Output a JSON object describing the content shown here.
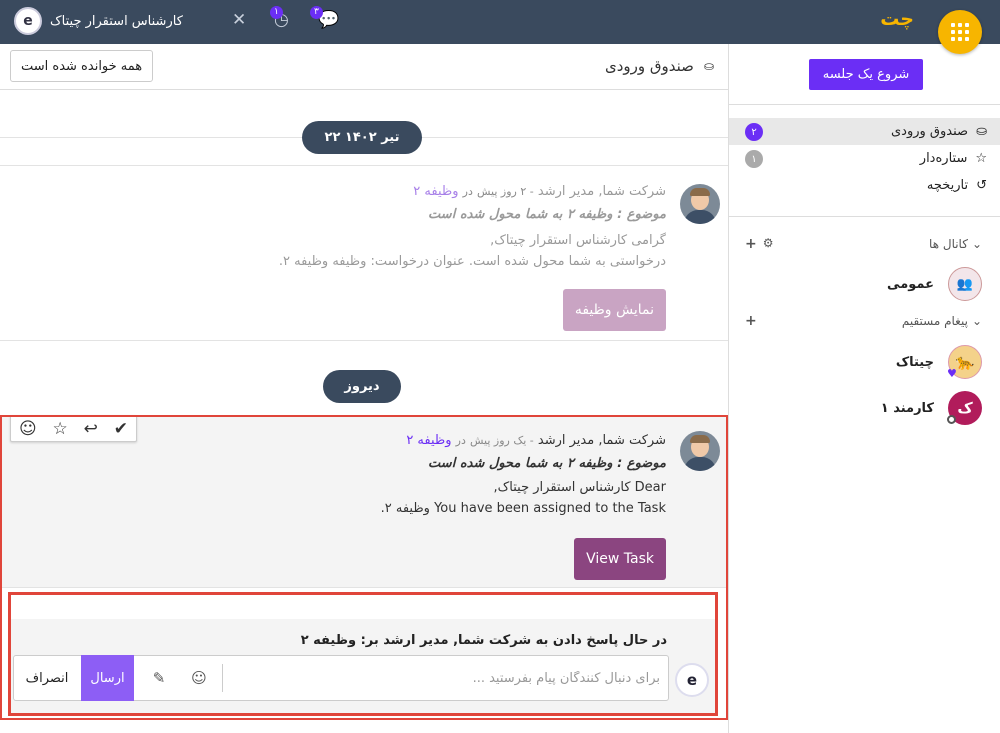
{
  "topbar": {
    "app_title": "چت",
    "user_name": "کارشناس استقرار چیتاک",
    "user_initial": "e",
    "messages_count": "۳",
    "activities_count": "۱",
    "apps_icon": "grid-icon",
    "messages_icon": "chat-bubbles-icon",
    "activities_icon": "clock-icon",
    "close_icon": "close-icon"
  },
  "sidebar": {
    "start_meeting": "شروع یک جلسه",
    "mailboxes": [
      {
        "label": "صندوق ورودی",
        "icon": "inbox-icon",
        "counter": "۲"
      },
      {
        "label": "ستاره‌دار",
        "icon": "star-icon",
        "counter": "۱"
      },
      {
        "label": "تاریخچه",
        "icon": "history-icon"
      }
    ],
    "channels_header": "کانال ها",
    "channels": [
      {
        "label": "عمومی",
        "icon": "group-icon"
      }
    ],
    "direct_header": "پیغام مستقیم",
    "direct": [
      {
        "label": "چیتاک",
        "icon": "cheetah-icon"
      },
      {
        "label": "کارمند ۱",
        "initial": "ک"
      }
    ]
  },
  "main": {
    "inbox_title": "صندوق ورودی",
    "mark_all_read": "همه خوانده شده است",
    "date_1": "۲۲ تیر ۱۴۰۲",
    "date_2": "دیروز",
    "messages": [
      {
        "author": "شرکت شما, مدیر ارشد",
        "time": "- ۲ روز پیش",
        "in": "در",
        "record": "وظیفه ۲",
        "subject": "موضوع : وظیفه ۲ به شما محول شده است",
        "line1": "گرامی کارشناس استقرار چیتاک,",
        "line2": "درخواستی به شما محول شده است. عنوان درخواست: وظیفه وظیفه ۲.",
        "button": "نمایش وظیفه"
      },
      {
        "author": "شرکت شما, مدیر ارشد",
        "time": "- یک روز پیش",
        "in": "در",
        "record": "وظیفه ۲",
        "subject": "موضوع : وظیفه ۲ به شما محول شده است",
        "line1": "Dear کارشناس استقرار چیتاک,",
        "line2": "You have been assigned to the Task وظیفه ۲.",
        "button": "View Task"
      }
    ]
  },
  "composer": {
    "replying_to": "در حال پاسخ دادن به شرکت شما, مدیر ارشد بر: وظیفه ۲",
    "placeholder": "برای دنبال کنندگان پیام بفرستید ...",
    "value": "",
    "send": "ارسال",
    "cancel": "انصراف",
    "emoji_icon": "smiley-icon",
    "attach_icon": "paperclip-icon"
  },
  "colors": {
    "navbar": "#3a4a5e",
    "accent": "#6b2ef5",
    "apps_button": "#f7b500",
    "highlight": "#e0453a",
    "faded_button": "#c9a4c3",
    "view_button": "#8b4580"
  }
}
